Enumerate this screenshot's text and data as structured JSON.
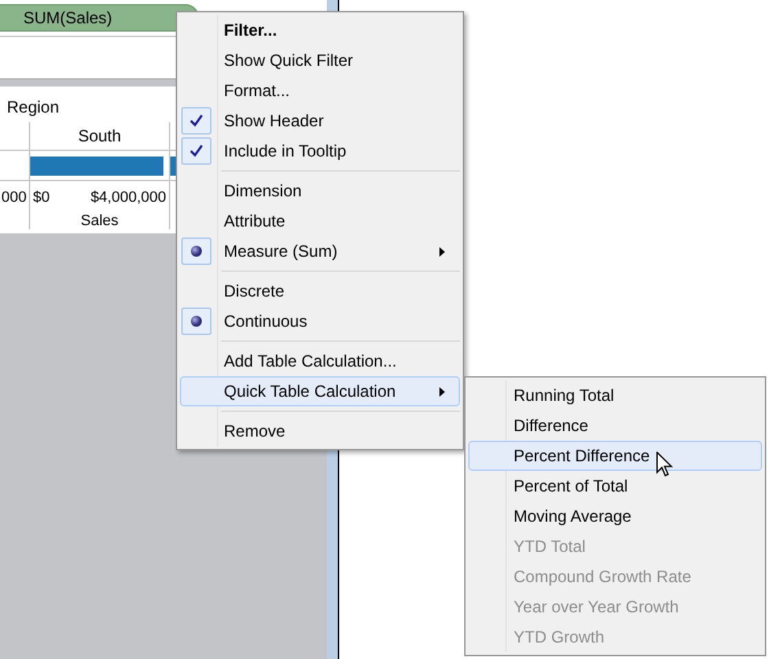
{
  "shelf": {
    "pill": "SUM(Sales)"
  },
  "chart": {
    "dimension_label": "Region",
    "column_header": "South",
    "axis_labels": [
      "000",
      "$0",
      "$4,000,000"
    ],
    "axis_title": "Sales"
  },
  "context_menu": {
    "items": [
      {
        "kind": "command",
        "label": "Filter...",
        "bold": true,
        "selected": false
      },
      {
        "kind": "command",
        "label": "Show Quick Filter",
        "selected": false
      },
      {
        "kind": "command",
        "label": "Format...",
        "selected": false
      },
      {
        "kind": "check",
        "label": "Show Header",
        "checked": true,
        "selected": false
      },
      {
        "kind": "check",
        "label": "Include in Tooltip",
        "checked": true,
        "selected": false
      },
      {
        "kind": "separator"
      },
      {
        "kind": "radio",
        "label": "Dimension",
        "checked": false,
        "selected": false
      },
      {
        "kind": "radio",
        "label": "Attribute",
        "checked": false,
        "selected": false
      },
      {
        "kind": "radio",
        "label": "Measure (Sum)",
        "checked": true,
        "has_submenu": true,
        "selected": false
      },
      {
        "kind": "separator"
      },
      {
        "kind": "radio",
        "label": "Discrete",
        "checked": false,
        "selected": false
      },
      {
        "kind": "radio",
        "label": "Continuous",
        "checked": true,
        "selected": false
      },
      {
        "kind": "separator"
      },
      {
        "kind": "command",
        "label": "Add Table Calculation...",
        "selected": false
      },
      {
        "kind": "command",
        "label": "Quick Table Calculation",
        "has_submenu": true,
        "selected": true
      },
      {
        "kind": "separator"
      },
      {
        "kind": "command",
        "label": "Remove",
        "selected": false
      }
    ]
  },
  "submenu": {
    "items": [
      {
        "label": "Running Total",
        "disabled": false,
        "selected": false
      },
      {
        "label": "Difference",
        "disabled": false,
        "selected": false
      },
      {
        "label": "Percent Difference",
        "disabled": false,
        "selected": true
      },
      {
        "label": "Percent of Total",
        "disabled": false,
        "selected": false
      },
      {
        "label": "Moving Average",
        "disabled": false,
        "selected": false
      },
      {
        "label": "YTD Total",
        "disabled": true,
        "selected": false
      },
      {
        "label": "Compound Growth Rate",
        "disabled": true,
        "selected": false
      },
      {
        "label": "Year over Year Growth",
        "disabled": true,
        "selected": false
      },
      {
        "label": "YTD Growth",
        "disabled": true,
        "selected": false
      }
    ]
  }
}
